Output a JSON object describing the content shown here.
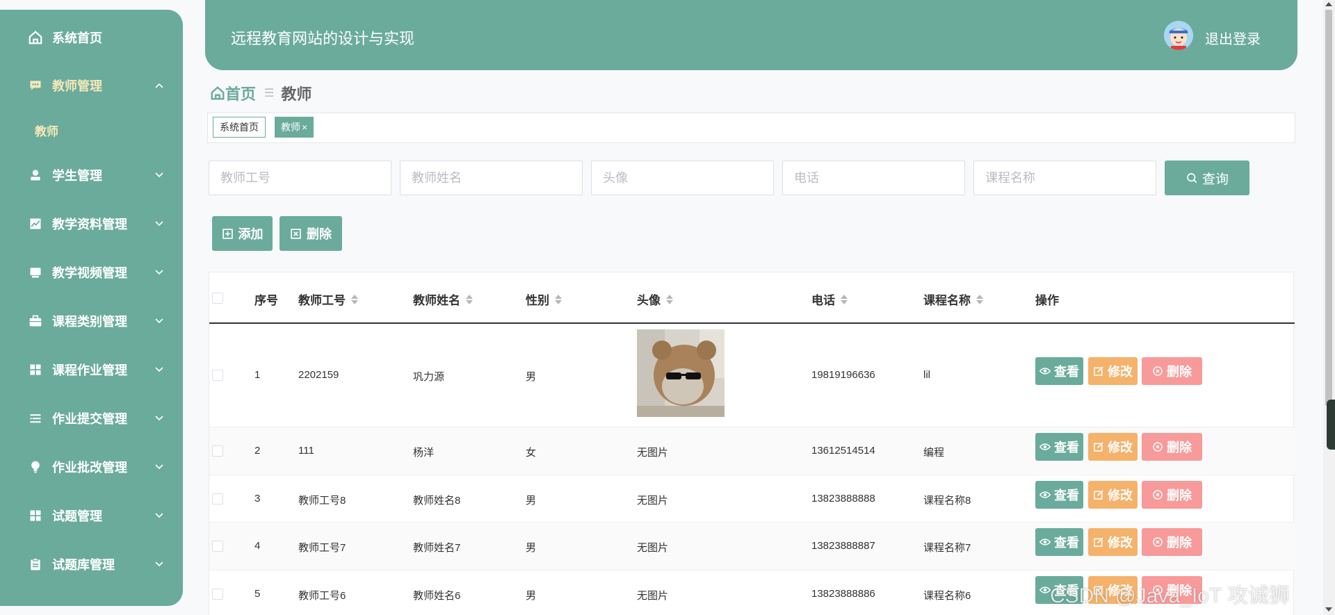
{
  "header": {
    "title": "远程教育网站的设计与实现",
    "logout": "退出登录"
  },
  "sidebar": {
    "items": [
      {
        "label": "系统首页",
        "icon": "home-icon"
      },
      {
        "label": "教师管理",
        "icon": "chat-icon",
        "expanded": true
      },
      {
        "label": "学生管理",
        "icon": "user-icon"
      },
      {
        "label": "教学资料管理",
        "icon": "chart-icon"
      },
      {
        "label": "教学视频管理",
        "icon": "tv-icon"
      },
      {
        "label": "课程类别管理",
        "icon": "briefcase-icon"
      },
      {
        "label": "课程作业管理",
        "icon": "grid-icon"
      },
      {
        "label": "作业提交管理",
        "icon": "list-icon"
      },
      {
        "label": "作业批改管理",
        "icon": "bulb-icon"
      },
      {
        "label": "试题管理",
        "icon": "grid-icon"
      },
      {
        "label": "试题库管理",
        "icon": "clipboard-icon"
      }
    ],
    "submenu": {
      "label": "教师"
    }
  },
  "breadcrumb": {
    "home": "首页",
    "current": "教师"
  },
  "tags": {
    "home": "系统首页",
    "current": "教师"
  },
  "search": {
    "teacher_no": "教师工号",
    "teacher_name": "教师姓名",
    "avatar": "头像",
    "phone": "电话",
    "course": "课程名称",
    "query_label": "查询"
  },
  "actions": {
    "add": "添加",
    "delete": "删除"
  },
  "table": {
    "columns": {
      "index": "序号",
      "teacher_no": "教师工号",
      "teacher_name": "教师姓名",
      "gender": "性别",
      "avatar": "头像",
      "phone": "电话",
      "course": "课程名称",
      "ops": "操作"
    },
    "op_labels": {
      "view": "查看",
      "edit": "修改",
      "remove": "删除"
    },
    "rows": [
      {
        "index": "1",
        "teacher_no": "2202159",
        "teacher_name": "巩力源",
        "gender": "男",
        "avatar": "",
        "phone": "19819196636",
        "course": "lil"
      },
      {
        "index": "2",
        "teacher_no": "111",
        "teacher_name": "杨洋",
        "gender": "女",
        "avatar": "无图片",
        "phone": "13612514514",
        "course": "编程"
      },
      {
        "index": "3",
        "teacher_no": "教师工号8",
        "teacher_name": "教师姓名8",
        "gender": "男",
        "avatar": "无图片",
        "phone": "13823888888",
        "course": "课程名称8"
      },
      {
        "index": "4",
        "teacher_no": "教师工号7",
        "teacher_name": "教师姓名7",
        "gender": "男",
        "avatar": "无图片",
        "phone": "13823888887",
        "course": "课程名称7"
      },
      {
        "index": "5",
        "teacher_no": "教师工号6",
        "teacher_name": "教师姓名6",
        "gender": "男",
        "avatar": "无图片",
        "phone": "13823888886",
        "course": "课程名称6"
      }
    ]
  },
  "watermark": "CSDN @Java_IoT 攻诚狮",
  "colors": {
    "primary": "#6aab9c",
    "edit": "#f5b26a",
    "remove": "#f89a9a",
    "active_text": "#f6e8b8"
  }
}
